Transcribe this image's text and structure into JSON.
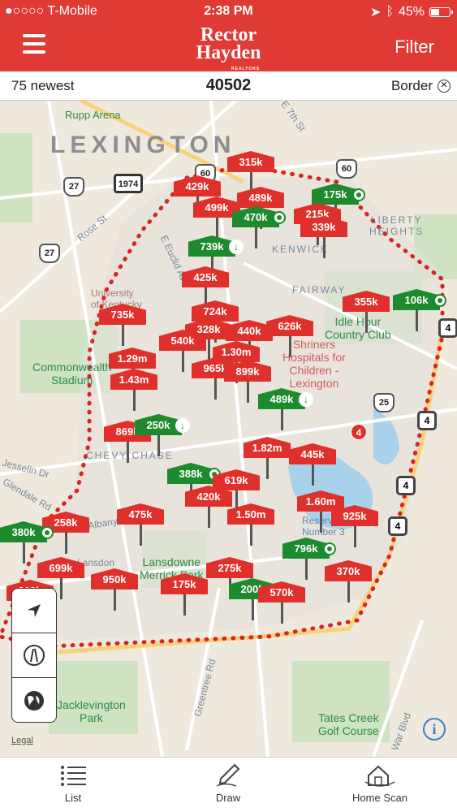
{
  "status_bar": {
    "carrier": "●○○○○ T-Mobile",
    "time": "2:38 PM",
    "battery": "45%",
    "battery_level": 0.45
  },
  "header": {
    "logo_line1": "Rector",
    "logo_line2": "Hayden",
    "logo_tagline": "REALTORS",
    "filter_label": "Filter"
  },
  "info_bar": {
    "count_label": "75 newest",
    "zip": "40502",
    "border_label": "Border"
  },
  "map": {
    "city": "LEXINGTON",
    "labels": {
      "rupp": "Rupp Arena",
      "seventh": "E 7th St",
      "rose": "Rose St",
      "euclid": "E Euclid Ave",
      "kenwick": "KENWICK",
      "fairway": "FAIRWAY",
      "liberty": "LIBERTY\nHEIGHTS",
      "university": "University\nof Kentucky",
      "commonwealth": "Commonwealth\nStadium",
      "idlehour": "Idle Hour\nCountry Club",
      "shriners": "Shriners\nHospitals for\nChildren -\nLexington",
      "chevy": "CHEVY CHASE",
      "reservoir": "Reservoir\nNumber 3",
      "lansdowne": "Lansdowne\nMerrick Park",
      "jesselin": "Jesselin Dr",
      "glendale": "Glendale Rd",
      "albany": "Albany Rd",
      "greentree": "Greentree Rd",
      "jacklevington": "Jacklevington\nPark",
      "tatescreek": "Tates Creek\nGolf Course",
      "warblvd": "War Blvd",
      "lansdon": "Lansdon"
    },
    "routes": [
      "1974",
      "27",
      "27",
      "60",
      "60",
      "25",
      "4",
      "4",
      "4",
      "4"
    ],
    "pins": [
      {
        "price": "315k",
        "color": "red"
      },
      {
        "price": "429k",
        "color": "red"
      },
      {
        "price": "489k",
        "color": "red"
      },
      {
        "price": "499k",
        "color": "red"
      },
      {
        "price": "175k",
        "color": "green",
        "marker": "dot"
      },
      {
        "price": "470k",
        "color": "green",
        "marker": "dot"
      },
      {
        "price": "215k",
        "color": "red"
      },
      {
        "price": "339k",
        "color": "red"
      },
      {
        "price": "739k",
        "color": "green",
        "marker": "down"
      },
      {
        "price": "425k",
        "color": "red"
      },
      {
        "price": "735k",
        "color": "red"
      },
      {
        "price": "724k",
        "color": "red"
      },
      {
        "price": "355k",
        "color": "red"
      },
      {
        "price": "106k",
        "color": "green",
        "marker": "dot"
      },
      {
        "price": "328k",
        "color": "red"
      },
      {
        "price": "440k",
        "color": "red"
      },
      {
        "price": "626k",
        "color": "red"
      },
      {
        "price": "540k",
        "color": "red"
      },
      {
        "price": "1.29m",
        "color": "red"
      },
      {
        "price": "1.30m",
        "color": "red"
      },
      {
        "price": "965k",
        "color": "red"
      },
      {
        "price": "899k",
        "color": "red"
      },
      {
        "price": "1.43m",
        "color": "red"
      },
      {
        "price": "489k",
        "color": "green",
        "marker": "down"
      },
      {
        "price": "869k",
        "color": "red"
      },
      {
        "price": "250k",
        "color": "green",
        "marker": "down"
      },
      {
        "price": "1.82m",
        "color": "red"
      },
      {
        "price": "445k",
        "color": "red"
      },
      {
        "price": "388k",
        "color": "green",
        "marker": "dot"
      },
      {
        "price": "619k",
        "color": "red"
      },
      {
        "price": "420k",
        "color": "red"
      },
      {
        "price": "475k",
        "color": "red"
      },
      {
        "price": "1.50m",
        "color": "red"
      },
      {
        "price": "1.60m",
        "color": "red"
      },
      {
        "price": "925k",
        "color": "red"
      },
      {
        "price": "258k",
        "color": "red"
      },
      {
        "price": "380k",
        "color": "green",
        "marker": "dot"
      },
      {
        "price": "796k",
        "color": "green",
        "marker": "dot"
      },
      {
        "price": "699k",
        "color": "red"
      },
      {
        "price": "950k",
        "color": "red"
      },
      {
        "price": "275k",
        "color": "red"
      },
      {
        "price": "370k",
        "color": "red"
      },
      {
        "price": "175k",
        "color": "red"
      },
      {
        "price": "200k",
        "color": "green"
      },
      {
        "price": "570k",
        "color": "red"
      },
      {
        "price": "219k",
        "color": "red"
      }
    ],
    "cluster_count": "4",
    "legal": "Legal"
  },
  "tabs": [
    {
      "label": "List"
    },
    {
      "label": "Draw"
    },
    {
      "label": "Home Scan"
    }
  ],
  "colors": {
    "brand_red": "#e03a35",
    "pin_red": "#e0302c",
    "pin_green": "#1e8a2e",
    "boundary": "#d8261e"
  }
}
